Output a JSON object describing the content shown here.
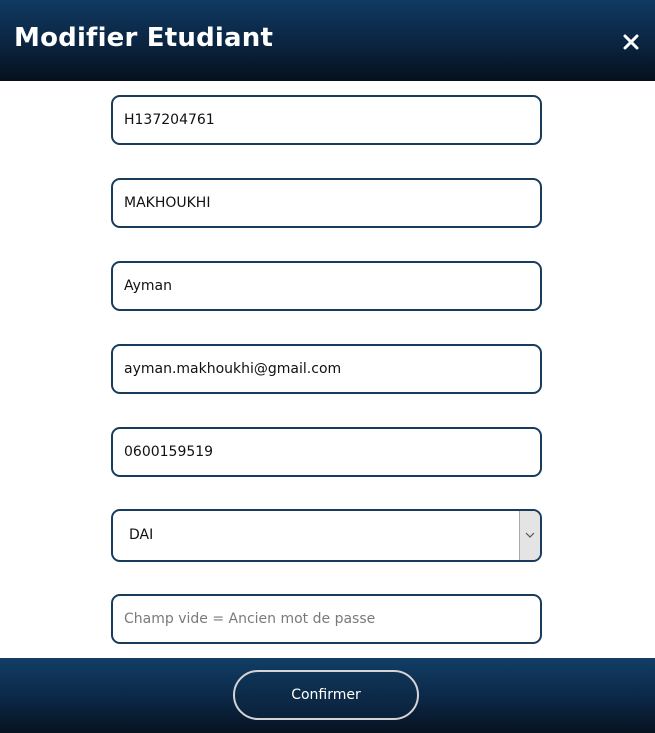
{
  "header": {
    "title": "Modifier Etudiant",
    "close_icon": "close-icon"
  },
  "form": {
    "fields": [
      {
        "name": "cne",
        "value": "H137204761",
        "placeholder": ""
      },
      {
        "name": "nom",
        "value": "MAKHOUKHI",
        "placeholder": ""
      },
      {
        "name": "prenom",
        "value": "Ayman",
        "placeholder": ""
      },
      {
        "name": "email",
        "value": "ayman.makhoukhi@gmail.com",
        "placeholder": ""
      },
      {
        "name": "telephone",
        "value": "0600159519",
        "placeholder": ""
      }
    ],
    "filiere": {
      "selected": "DAI"
    },
    "password": {
      "value": "",
      "placeholder": "Champ vide = Ancien mot de passe"
    }
  },
  "footer": {
    "confirm_label": "Confirmer"
  },
  "colors": {
    "header_bg": "#0a2440",
    "field_border": "#183c5e",
    "button_border": "#d4d4d4"
  }
}
